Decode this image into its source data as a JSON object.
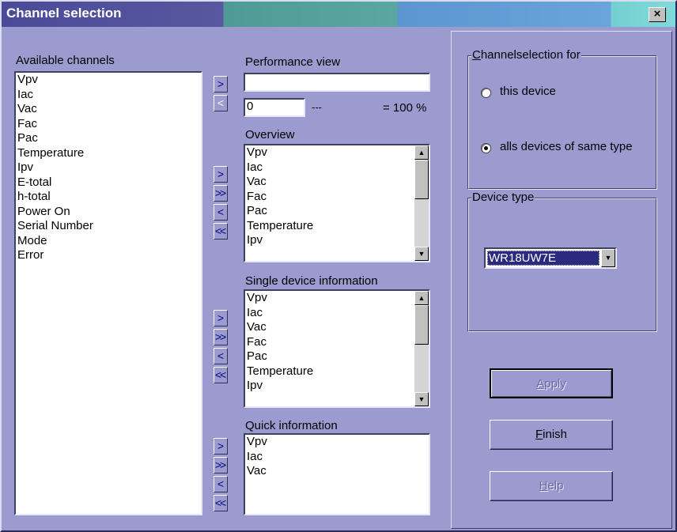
{
  "window": {
    "title": "Channel selection",
    "close_glyph": "×"
  },
  "available": {
    "label": "Available channels",
    "items": [
      "Vpv",
      "Iac",
      "Vac",
      "Fac",
      "Pac",
      "Temperature",
      "Ipv",
      "E-total",
      "h-total",
      "Power On",
      "Serial Number",
      "Mode",
      "Error"
    ]
  },
  "performance": {
    "label": "Performance view",
    "value": "",
    "min_value": "0",
    "dash": "---",
    "suffix": "= 100 %"
  },
  "overview": {
    "label": "Overview",
    "items": [
      "Vpv",
      "Iac",
      "Vac",
      "Fac",
      "Pac",
      "Temperature",
      "Ipv"
    ]
  },
  "single": {
    "label": "Single device information",
    "items": [
      "Vpv",
      "Iac",
      "Vac",
      "Fac",
      "Pac",
      "Temperature",
      "Ipv"
    ]
  },
  "quick": {
    "label": "Quick information",
    "items": [
      "Vpv",
      "Iac",
      "Vac"
    ]
  },
  "buttons": {
    "add": ">",
    "add_all": ">>",
    "remove": "<",
    "remove_all": "<<"
  },
  "channelselection": {
    "title_accel": "C",
    "title_rest": "hannelselection for",
    "option_this": "this device",
    "option_all": "alls devices of same type",
    "selected": "all"
  },
  "device_type": {
    "title": "Device type",
    "value": "WR18UW7E"
  },
  "actions": {
    "apply_accel": "A",
    "apply_rest": "pply",
    "finish_accel": "F",
    "finish_rest": "inish",
    "help_accel": "H",
    "help_rest": "elp"
  },
  "icons": {
    "scroll_up": "▲",
    "scroll_down": "▼",
    "dropdown": "▼"
  }
}
